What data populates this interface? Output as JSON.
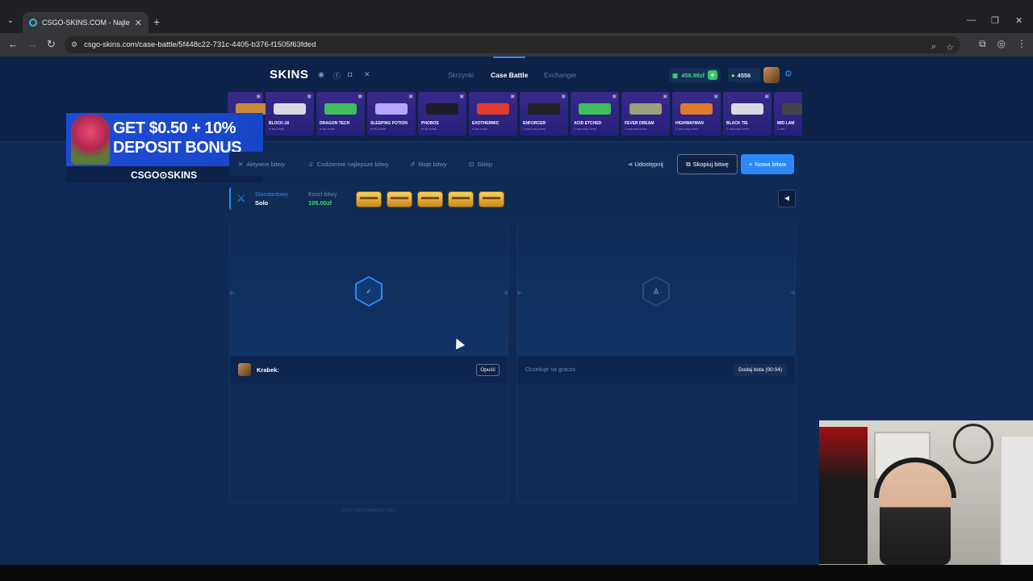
{
  "browser": {
    "tab_title": "CSGO-SKINS.COM - Najlepsze",
    "tab_close": "✕",
    "new_tab": "+",
    "url": "csgo-skins.com/case-battle/5f448c22-731c-4405-b376-f1505f63fded",
    "window_controls": [
      "—",
      "❐",
      "✕"
    ]
  },
  "header": {
    "logo": "SKINS",
    "nav": [
      "Skrzynki",
      "Case Battle",
      "Exchanger"
    ],
    "active_nav": "Case Battle",
    "balance": "458.98zł",
    "coins": "4556"
  },
  "promo": {
    "line1": "GET $0.50 + 10%",
    "line2": "DEPOSIT BONUS",
    "logo": "CSGO⊙SKINS"
  },
  "live_drops": [
    {
      "name": "",
      "sub": "",
      "color": "#c98a3a"
    },
    {
      "name": "BLOCK-18",
      "sub": "w tej chwili",
      "color": "#d9d9e6"
    },
    {
      "name": "DRAGON TECH",
      "sub": "w tej chwili",
      "color": "#3fbf5c"
    },
    {
      "name": "SLEEPING POTION",
      "sub": "w tej chwili",
      "color": "#b8a6ff"
    },
    {
      "name": "PHOBOS",
      "sub": "w tej chwili",
      "color": "#1d1d2b"
    },
    {
      "name": "EXOTHERMIC",
      "sub": "w tej chwili",
      "color": "#e23b2f"
    },
    {
      "name": "ENFORCER",
      "sub": "2 sekundy temu",
      "color": "#222"
    },
    {
      "name": "ACID ETCHED",
      "sub": "2 sekundy temu",
      "color": "#3fbf5c"
    },
    {
      "name": "FEVER DREAM",
      "sub": "2 sekundy temu",
      "color": "#9aa37a"
    },
    {
      "name": "HIGHWAYMAN",
      "sub": "2 sekundy temu",
      "color": "#e07a2c"
    },
    {
      "name": "BLACK TIE",
      "sub": "2 sekundy temu",
      "color": "#d9d9e6"
    },
    {
      "name": "MID LAM",
      "sub": "2 sek",
      "color": "#444"
    }
  ],
  "toolbar": {
    "items": [
      "Aktywne bitwy",
      "Codzienne najlepsze bitwy",
      "Moje bitwy",
      "Sklep"
    ],
    "share": "Udostępnij",
    "copy": "Skopiuj bitwę",
    "new": "Nowa bitwa"
  },
  "battle": {
    "mode_type": "Standardowy",
    "mode_name": "Solo",
    "cost_label": "Koszt bitwy",
    "cost_value": "105.00zł",
    "case_count": 5
  },
  "players": [
    {
      "name": "Krabek:",
      "action": "Opuść",
      "status": "ready"
    },
    {
      "waiting": "Oczekuje na gracza",
      "action": "Dodaj bota (00:04)",
      "status": "empty"
    }
  ],
  "battle_hash": "CSGO SKINS 5f448c22-731c"
}
